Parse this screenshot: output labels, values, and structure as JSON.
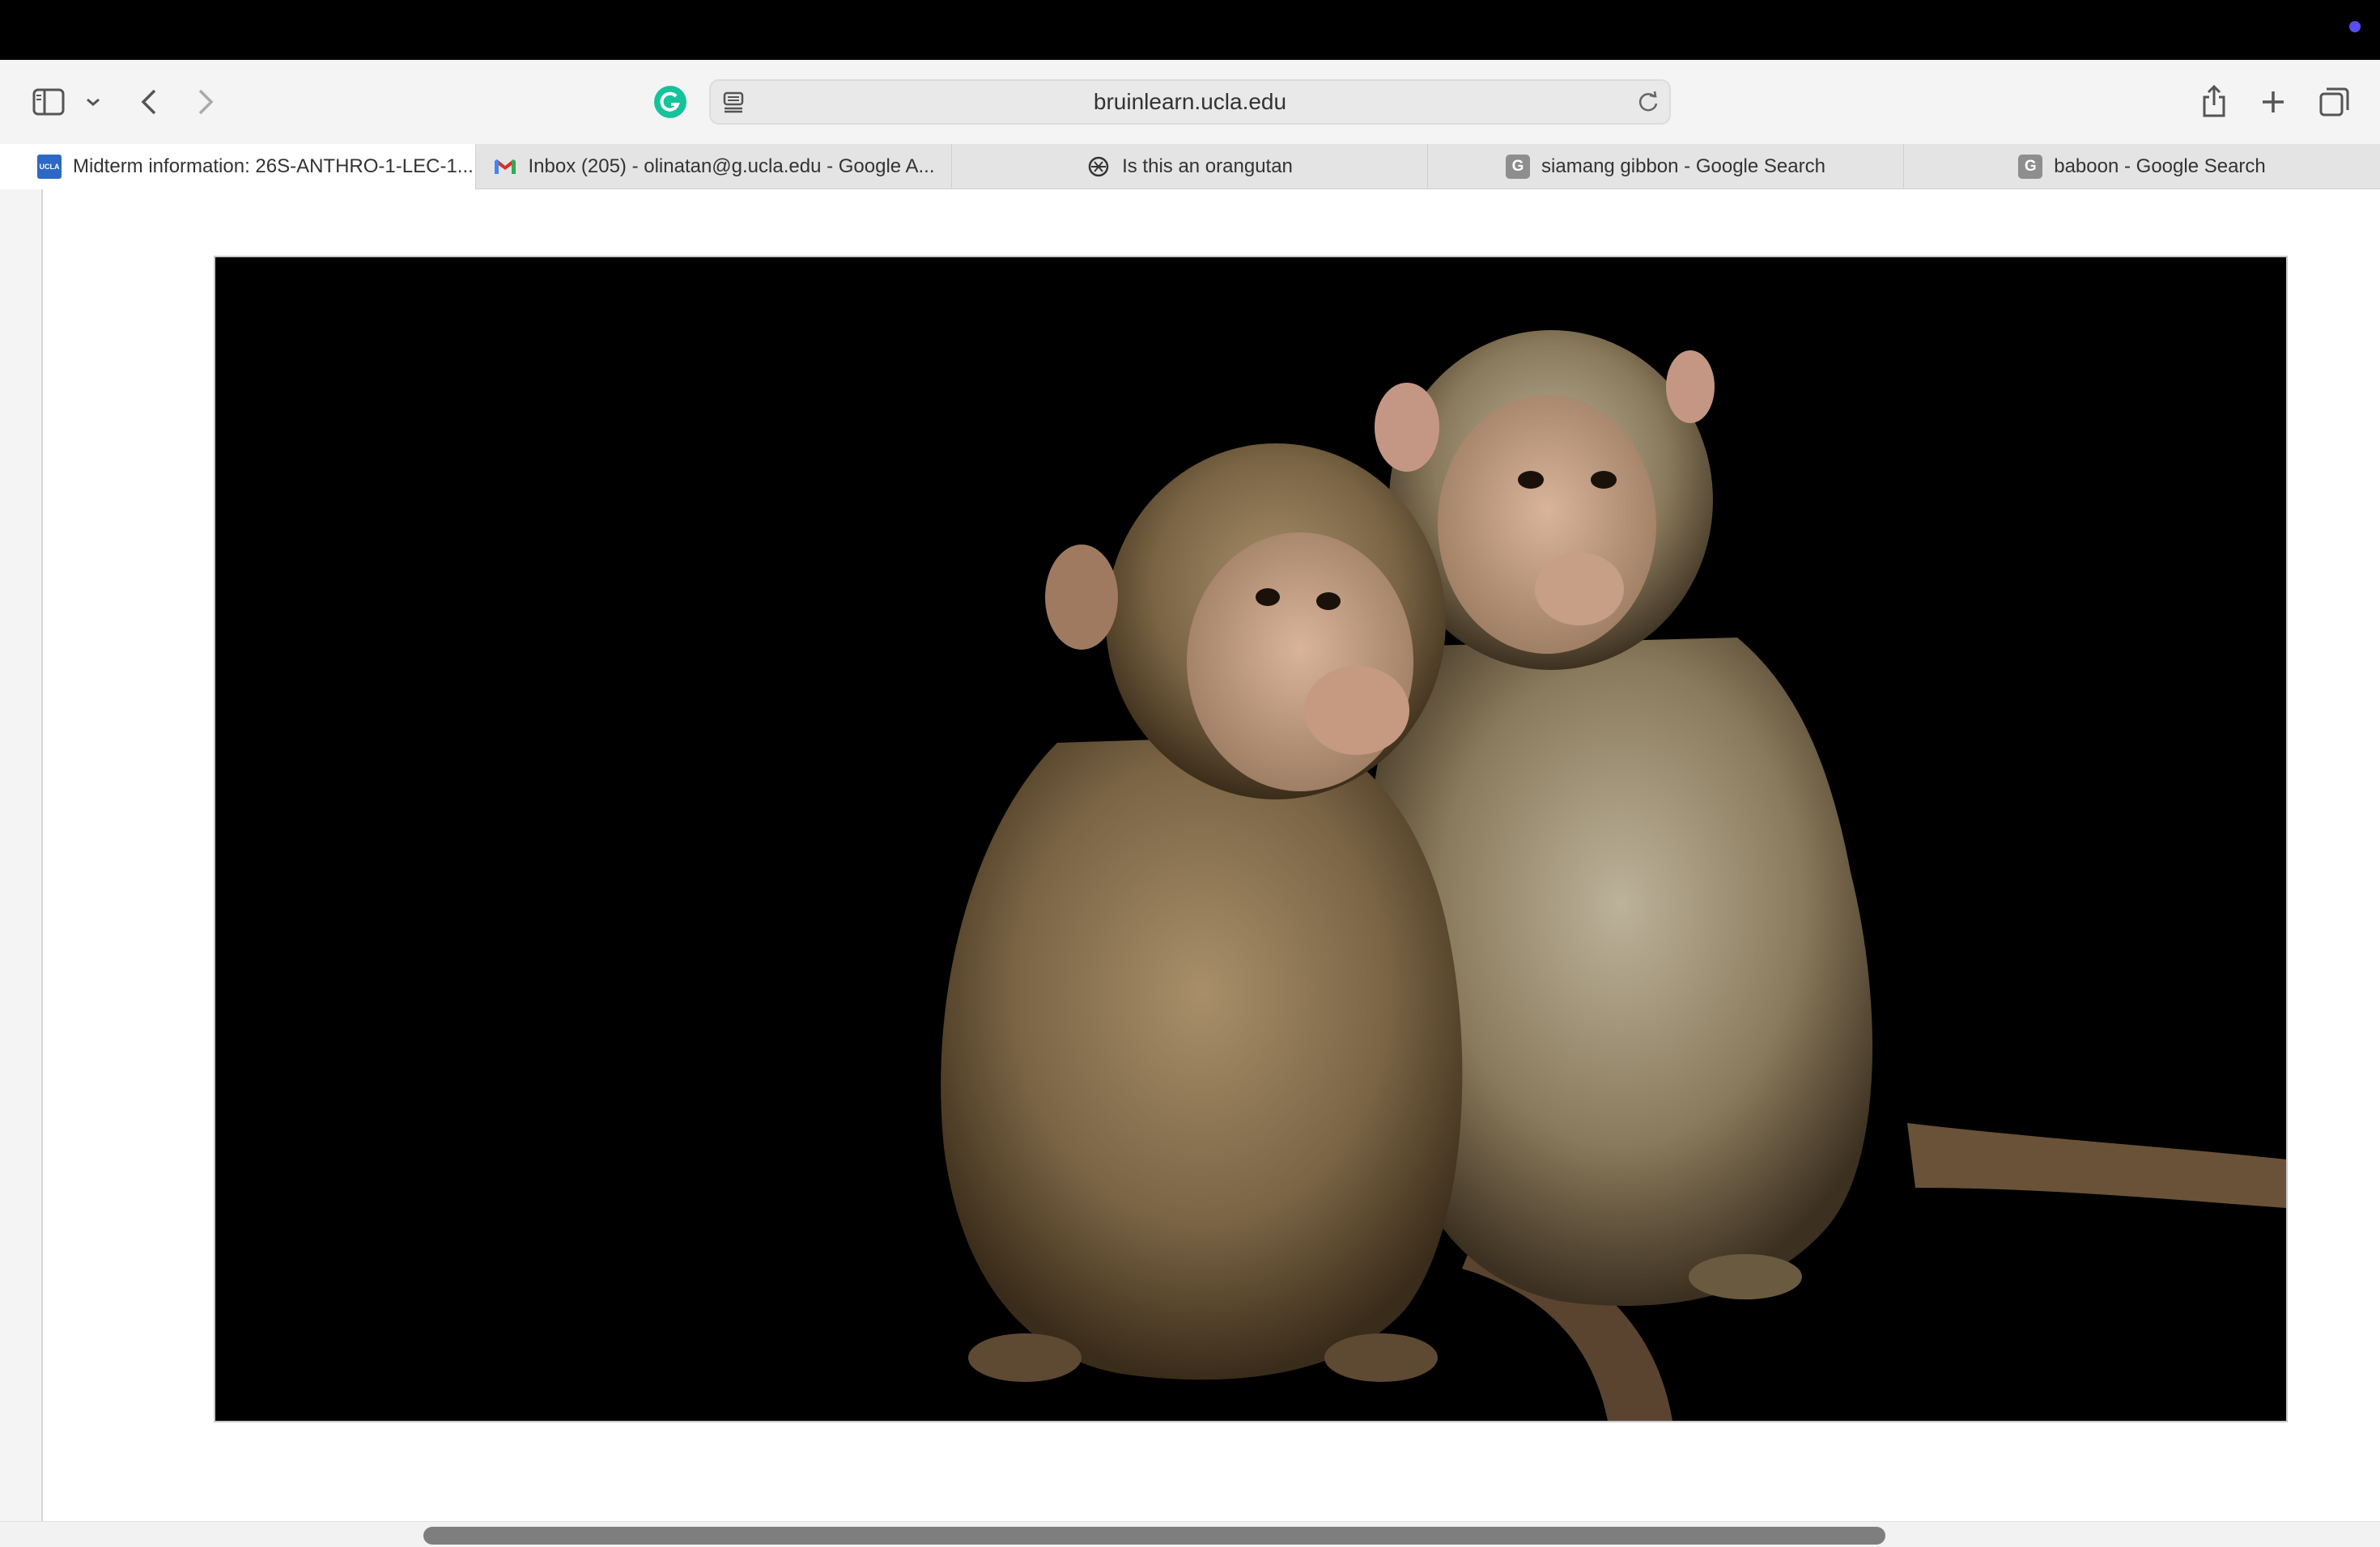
{
  "browser": {
    "address": {
      "url": "bruinlearn.ucla.edu"
    },
    "tabs": [
      {
        "label": "Midterm information: 26S-ANTHRO-1-LEC-1...",
        "favicon": "ucla-favicon",
        "favicon_text": "UCLA",
        "active": true
      },
      {
        "label": "Inbox (205) - olinatan@g.ucla.edu - Google A...",
        "favicon": "gmail-icon",
        "active": false
      },
      {
        "label": "Is this an orangutan",
        "favicon": "chatgpt-icon",
        "active": false
      },
      {
        "label": "siamang gibbon - Google Search",
        "favicon": "google-icon",
        "favicon_text": "G",
        "active": false
      },
      {
        "label": "baboon - Google Search",
        "favicon": "google-icon",
        "favicon_text": "G",
        "active": false
      }
    ],
    "icons": {
      "sidebar": "sidebar-icon",
      "tab_group_menu": "chevron-down-icon",
      "back": "back-icon",
      "forward": "forward-icon",
      "extension": "grammarly-icon",
      "reader": "reader-icon",
      "reload": "reload-icon",
      "share": "share-icon",
      "new_tab": "plus-icon",
      "tab_overview": "tab-overview-icon"
    },
    "colors": {
      "accent_dot": "#5a4cf0",
      "grammarly": "#15c39a"
    }
  },
  "page": {
    "image": "photo of two macaque monkeys on black background"
  }
}
